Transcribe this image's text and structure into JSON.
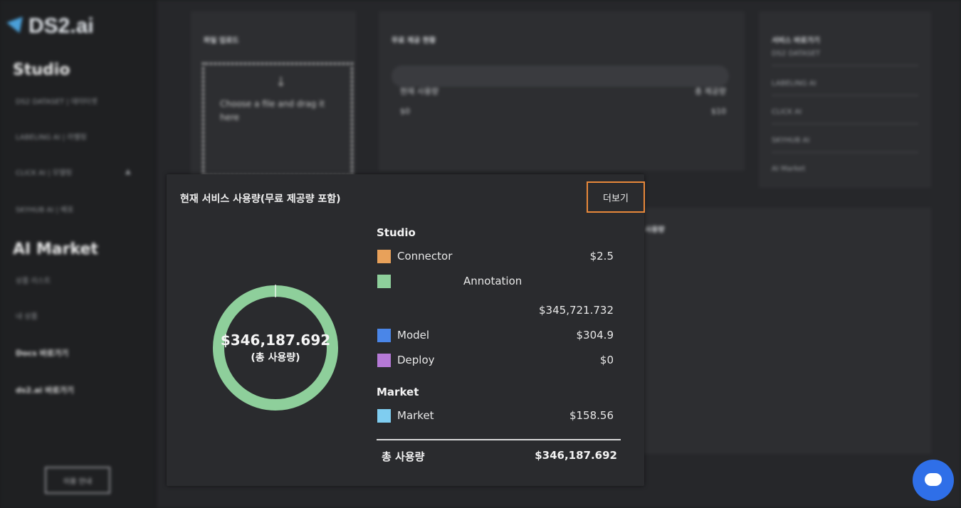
{
  "background": {
    "logo": "DS2.ai",
    "sidebar": {
      "section_studio": "Studio",
      "studio_items": [
        "DS2 DATASET | 데이터셋",
        "LABELING AI | 라벨링",
        "CLICK AI | 모델링",
        "SKYHUB AI | 배포"
      ],
      "section_market": "AI Market",
      "market_items": [
        "상품 리스트",
        "내 상품"
      ],
      "extra_items": [
        "Docs 바로가기",
        "ds2.ai 바로가기"
      ],
      "bottom_button": "이용 안내"
    },
    "cards": {
      "upload_title": "파일 업로드",
      "dropzone_text": "Choose a file and drag it here",
      "usage_title": "무료 제공 현황",
      "used_label": "현재 사용량",
      "used_value": "$0",
      "provided_label": "총 제공량",
      "provided_value": "$10",
      "links_title": "서비스 바로가기",
      "links": [
        "DS2 DATASET",
        "LABELING AI",
        "CLICK AI",
        "SKYHUB AI",
        "AI Market"
      ],
      "lower_title": "사용량"
    }
  },
  "popup": {
    "title": "현재 서비스 사용량(무료 제공량 포함)",
    "more_button": "더보기",
    "donut_total": "$346,187.692",
    "donut_caption": "(총 사용량)",
    "studio_heading": "Studio",
    "studio": [
      {
        "label": "Connector",
        "value": "$2.5",
        "color": "#e8a15a"
      },
      {
        "label": "Annotation",
        "value": "$345,721.732",
        "color": "#8ecf9b"
      },
      {
        "label": "Model",
        "value": "$304.9",
        "color": "#4a86e8"
      },
      {
        "label": "Deploy",
        "value": "$0",
        "color": "#b579d6"
      }
    ],
    "market_heading": "Market",
    "market": [
      {
        "label": "Market",
        "value": "$158.56",
        "color": "#7fcdf0"
      }
    ],
    "total_label": "총 사용량",
    "total_value": "$346,187.692"
  }
}
